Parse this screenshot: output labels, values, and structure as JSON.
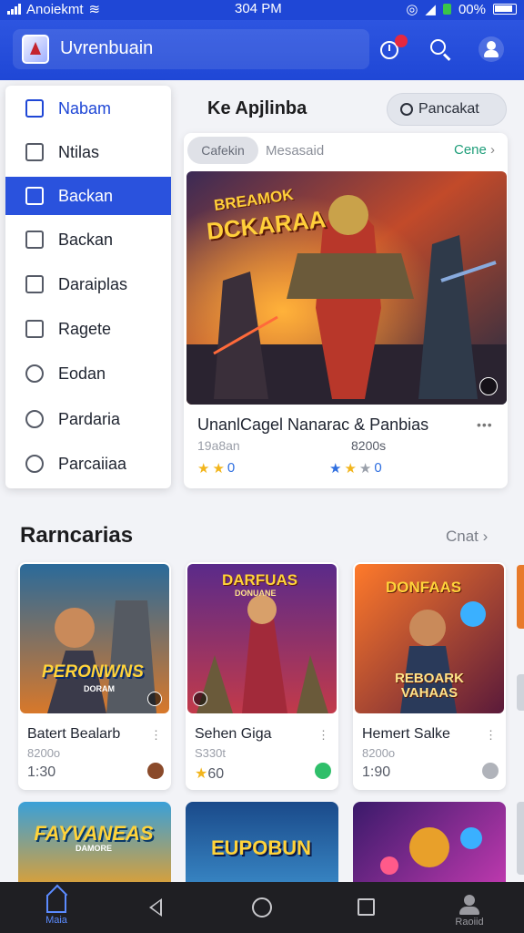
{
  "status_bar": {
    "carrier": "Anoiekmt",
    "time": "304 PM",
    "battery": "00%"
  },
  "app_bar": {
    "title": "Uvrenbuain"
  },
  "drawer": {
    "items": [
      {
        "label": "Nabam",
        "icon": "home-icon",
        "state": "home"
      },
      {
        "label": "Ntilas",
        "icon": "box-icon",
        "state": ""
      },
      {
        "label": "Backan",
        "icon": "bookmark-icon",
        "state": "active"
      },
      {
        "label": "Backan",
        "icon": "flag-icon",
        "state": ""
      },
      {
        "label": "Daraiplas",
        "icon": "square-icon",
        "state": ""
      },
      {
        "label": "Ragete",
        "icon": "note-icon",
        "state": ""
      },
      {
        "label": "Eodan",
        "icon": "percent-icon",
        "state": ""
      },
      {
        "label": "Pardaria",
        "icon": "clock-icon",
        "state": ""
      },
      {
        "label": "Parcaiiaa",
        "icon": "compass-icon",
        "state": ""
      }
    ]
  },
  "featured": {
    "section_title": "Ke Apjlinba",
    "search_button": "Pancakat",
    "chip": "Cafekin",
    "tab2": "Mesasaid",
    "see_all": "Cene",
    "image_title_line1": "BREAMOK",
    "image_title_line2": "DCKARAA",
    "name": "UnanlCagel Nanarac & Panbias",
    "sub_left": "19a8an",
    "sub_right": "8200s",
    "rating_left": "0",
    "rating_right": "0"
  },
  "games": {
    "title": "Rarncarias",
    "more": "Cnat",
    "cards": [
      {
        "name": "Batert Bealarb",
        "sub": "8200o",
        "rating": "1:30",
        "art_line1": "PERONWNS",
        "art_line2": "DORAM"
      },
      {
        "name": "Sehen Giga",
        "sub": "S330t",
        "rating": "60",
        "art_line1": "DARFUAS",
        "art_line2": "DONUANE"
      },
      {
        "name": "Hemert Salke",
        "sub": "8200o",
        "rating": "1:90",
        "art_line1": "DONFAAS",
        "art_line2": "REBOARK VAHAAS"
      }
    ],
    "row2": [
      {
        "art_line1": "FAYVANEAS",
        "art_line2": "DAMORE"
      },
      {
        "art_line1": "EUPOBUN",
        "art_line2": ""
      },
      {
        "art_line1": "",
        "art_line2": ""
      }
    ]
  },
  "nav": {
    "home_label": "Maia",
    "profile_label": "Raoiid"
  },
  "colors": {
    "primary": "#1f47d6",
    "accent_green": "#1f9e7a",
    "star": "#f2b51c"
  }
}
